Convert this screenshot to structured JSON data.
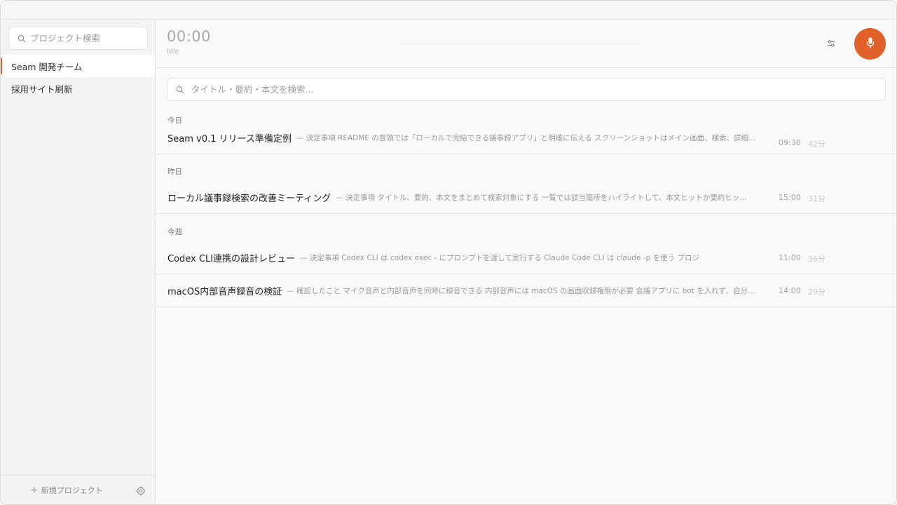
{
  "sidebar": {
    "search_placeholder": "プロジェクト検索",
    "projects": [
      {
        "label": "Seam 開発チーム",
        "active": true
      },
      {
        "label": "採用サイト刷新",
        "active": false
      }
    ],
    "new_project_label": "新規プロジェクト"
  },
  "recorder": {
    "timer": "00:00",
    "status": "Idle",
    "accent_color": "#e0622a"
  },
  "search": {
    "placeholder": "タイトル・要約・本文を検索..."
  },
  "groups": [
    {
      "label": "今日",
      "meetings": [
        {
          "title": "Seam v0.1 リリース準備定例",
          "snippet": "— 決定事項 README の冒頭では「ローカルで完結できる議事録アプリ」と明確に伝える スクリーンショットはメイン画面、検索、詳細...",
          "time": "09:30",
          "duration": "42分"
        }
      ]
    },
    {
      "label": "昨日",
      "meetings": [
        {
          "title": "ローカル議事録検索の改善ミーティング",
          "snippet": "— 決定事項 タイトル、要約、本文をまとめて検索対象にする 一覧では該当箇所をハイライトして、本文ヒットか要約ヒッ...",
          "time": "15:00",
          "duration": "31分"
        }
      ]
    },
    {
      "label": "今週",
      "meetings": [
        {
          "title": "Codex CLI連携の設計レビュー",
          "snippet": "— 決定事項 Codex CLI は codex exec - にプロンプトを渡して実行する Claude Code CLI は claude -p を使う プロジ",
          "time": "11:00",
          "duration": "36分"
        },
        {
          "title": "macOS内部音声録音の検証",
          "snippet": "— 確認したこと マイク音声と内部音声を同時に録音できる 内部音声には macOS の画面収録権限が必要 会議アプリに bot を入れず、自分...",
          "time": "14:00",
          "duration": "29分"
        }
      ]
    }
  ]
}
